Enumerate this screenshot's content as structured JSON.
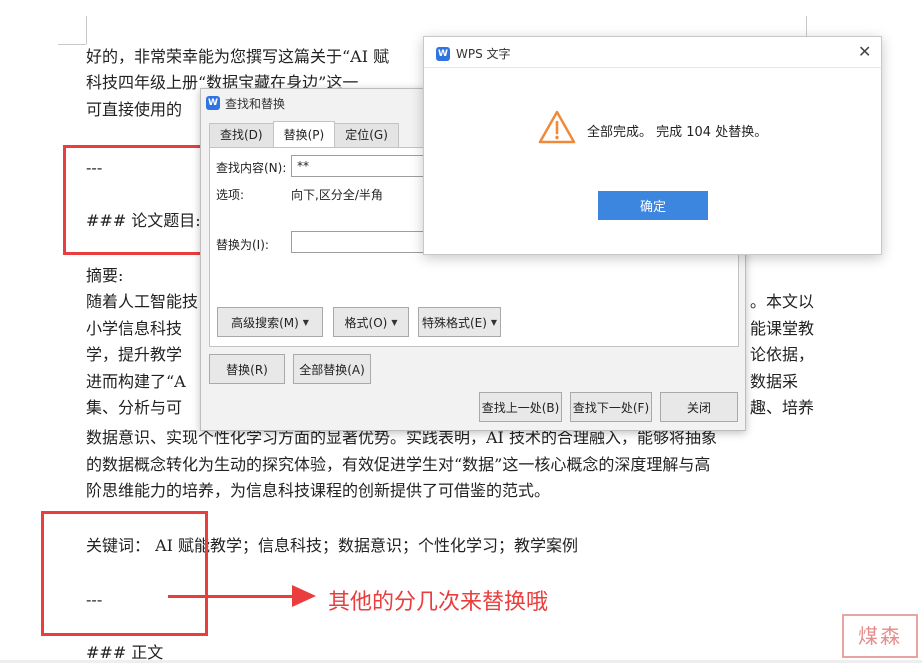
{
  "document": {
    "paragraphs": [
      "好的，非常荣幸能为您撰写这篇关于“AI 赋",
      "科技四年级上册“数据宝藏在身边”这一",
      "可直接使用的",
      "---",
      "### 论文题目:",
      "摘要:",
      "随着人工智能技",
      "小学信息科技",
      "学，提升教学",
      "进而构建了“A",
      "集、分析与可"
    ],
    "right_fragments": [
      "。本文以",
      "能课堂教",
      "论依据，",
      "数据采",
      "趣、培养"
    ],
    "lines_after": [
      "数据意识、实现个性化学习方面的显著优势。实践表明，AI 技术的合理融入，能够将抽象",
      "的数据概念转化为生动的探究体验，有效促进学生对“数据”这一核心概念的深度理解与高",
      "阶思维能力的培养，为信息科技课程的创新提供了可借鉴的范式。",
      "关键词： AI 赋能教学；信息科技；数据意识；个性化学习；教学案例",
      "---",
      "### 正文"
    ],
    "annotation": "其他的分几次来替换哦",
    "watermark": "煤森"
  },
  "find_replace": {
    "title": "查找和替换",
    "tabs": [
      "查找(D)",
      "替换(P)",
      "定位(G)"
    ],
    "find_label": "查找内容(N):",
    "find_value": "**",
    "options_label": "选项:",
    "options_value": "向下,区分全/半角",
    "replace_label": "替换为(I):",
    "replace_value": "",
    "advanced_btn": "高级搜索(M)",
    "format_btn": "格式(O)",
    "special_btn": "特殊格式(E)",
    "replace_btn": "替换(R)",
    "replace_all_btn": "全部替换(A)",
    "find_prev_btn": "查找上一处(B)",
    "find_next_btn": "查找下一处(F)",
    "close_btn": "关闭"
  },
  "message": {
    "title": "WPS 文字",
    "text": "全部完成。 完成 104 处替换。",
    "ok": "确定",
    "close_icon": "close-icon",
    "warning_icon": "warning-icon"
  },
  "colors": {
    "accent": "#3d86e0",
    "annotation_red": "#ea3d3d",
    "wps_blue": "#2f74e0"
  }
}
